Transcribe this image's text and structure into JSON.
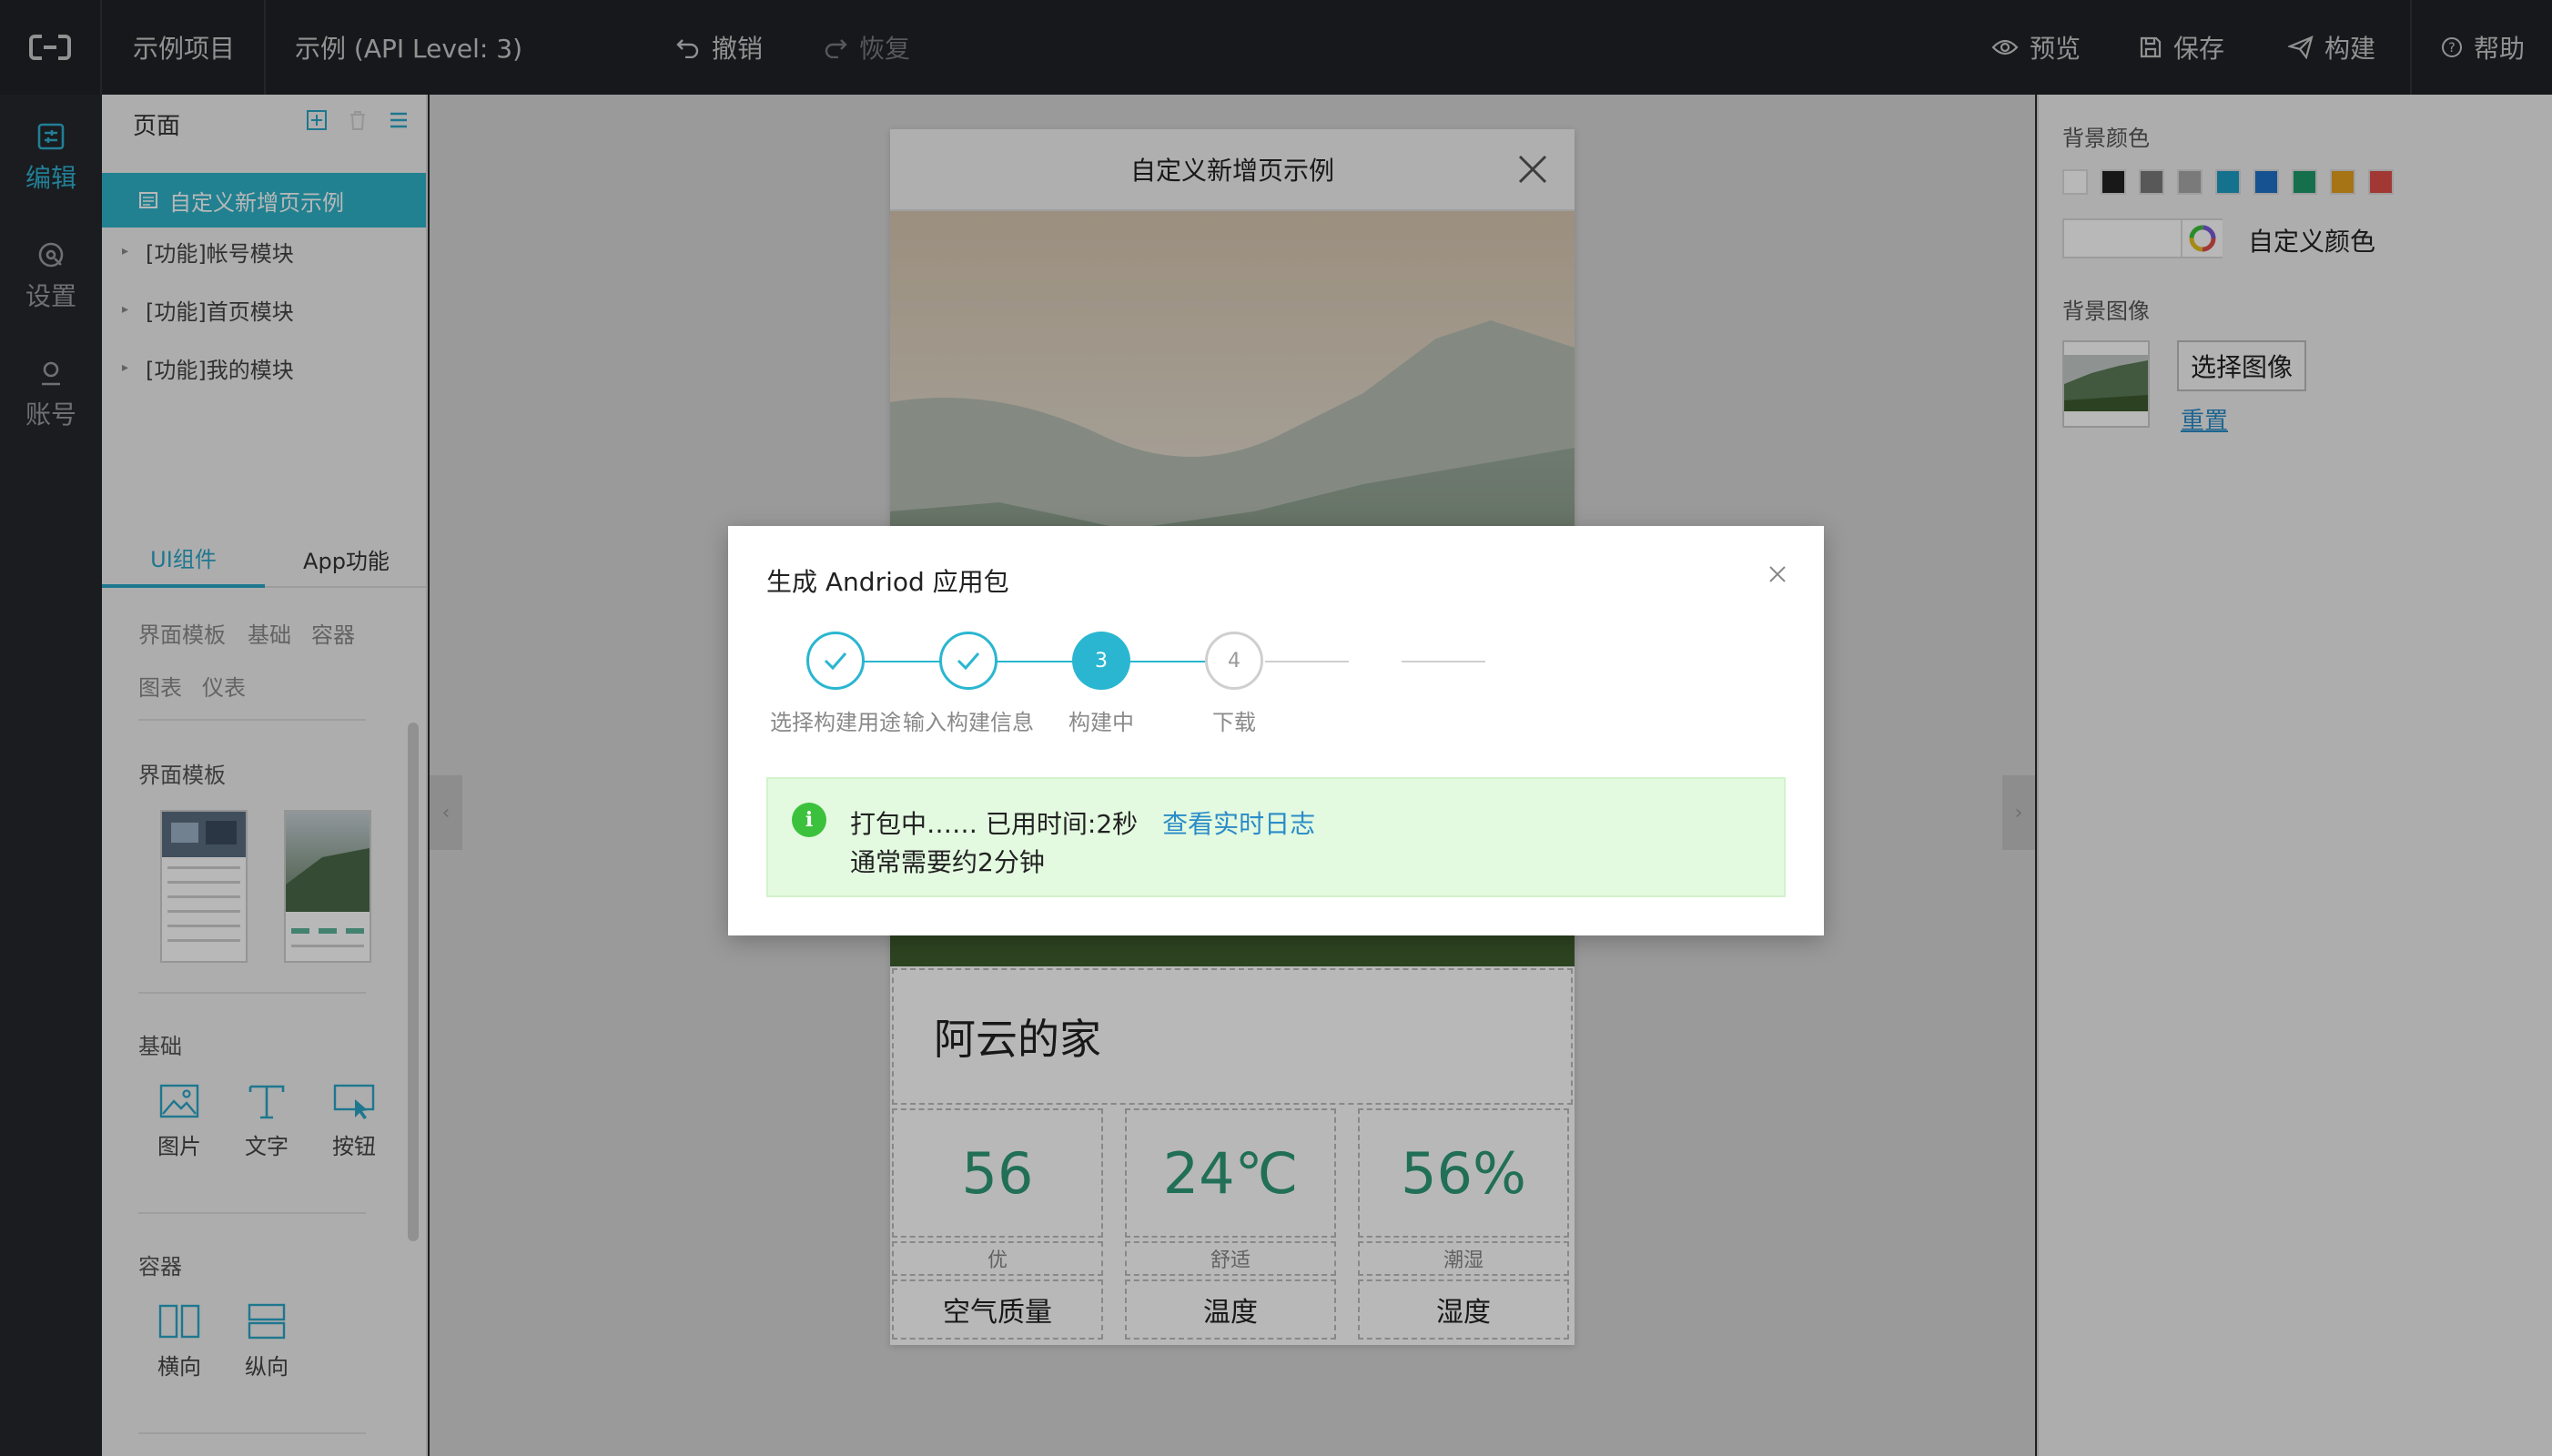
{
  "topbar": {
    "project": "示例项目",
    "app": "示例 (API Level: 3)",
    "undo": "撤销",
    "redo": "恢复",
    "preview": "预览",
    "save": "保存",
    "build": "构建",
    "help": "帮助"
  },
  "rail": {
    "edit": "编辑",
    "settings": "设置",
    "account": "账号"
  },
  "pages_panel": {
    "title": "页面",
    "items": [
      {
        "label": "自定义新增页示例"
      },
      {
        "label": "[功能]帐号模块"
      },
      {
        "label": "[功能]首页模块"
      },
      {
        "label": "[功能]我的模块"
      }
    ]
  },
  "component_tabs": {
    "ui": "UI组件",
    "app": "App功能"
  },
  "categories": [
    "界面模板",
    "基础",
    "容器",
    "图表",
    "仪表"
  ],
  "sections": {
    "templates": "界面模板",
    "basic": "基础",
    "basic_items": [
      "图片",
      "文字",
      "按钮"
    ],
    "container": "容器",
    "container_items": [
      "横向",
      "纵向"
    ]
  },
  "phone": {
    "title": "自定义新增页示例",
    "home_title": "阿云的家",
    "stats": [
      {
        "value": "56",
        "sub": "优",
        "label": "空气质量"
      },
      {
        "value": "24℃",
        "sub": "舒适",
        "label": "温度"
      },
      {
        "value": "56%",
        "sub": "潮湿",
        "label": "湿度"
      }
    ]
  },
  "right_panel": {
    "bg_color_label": "背景颜色",
    "swatches": [
      "#ffffff",
      "#222222",
      "#7a7a7a",
      "#a9a9a9",
      "#1e9fc7",
      "#1f72c9",
      "#1e9a6a",
      "#e6a01e",
      "#e04e48"
    ],
    "custom_color": "自定义颜色",
    "bg_image_label": "背景图像",
    "choose_image": "选择图像",
    "reset": "重置"
  },
  "modal": {
    "title": "生成 Andriod 应用包",
    "steps": [
      {
        "num": "1",
        "label": "选择构建用途",
        "state": "done"
      },
      {
        "num": "2",
        "label": "输入构建信息",
        "state": "done"
      },
      {
        "num": "3",
        "label": "构建中",
        "state": "active"
      },
      {
        "num": "4",
        "label": "下载",
        "state": "wait"
      }
    ],
    "alert_text": "打包中…… 已用时间:2秒",
    "alert_link": "查看实时日志",
    "alert_note": "通常需要约2分钟"
  },
  "colors": {
    "accent": "#2ab6d0",
    "success_bg": "#e3fae0",
    "stat_green": "#2e9a78"
  }
}
